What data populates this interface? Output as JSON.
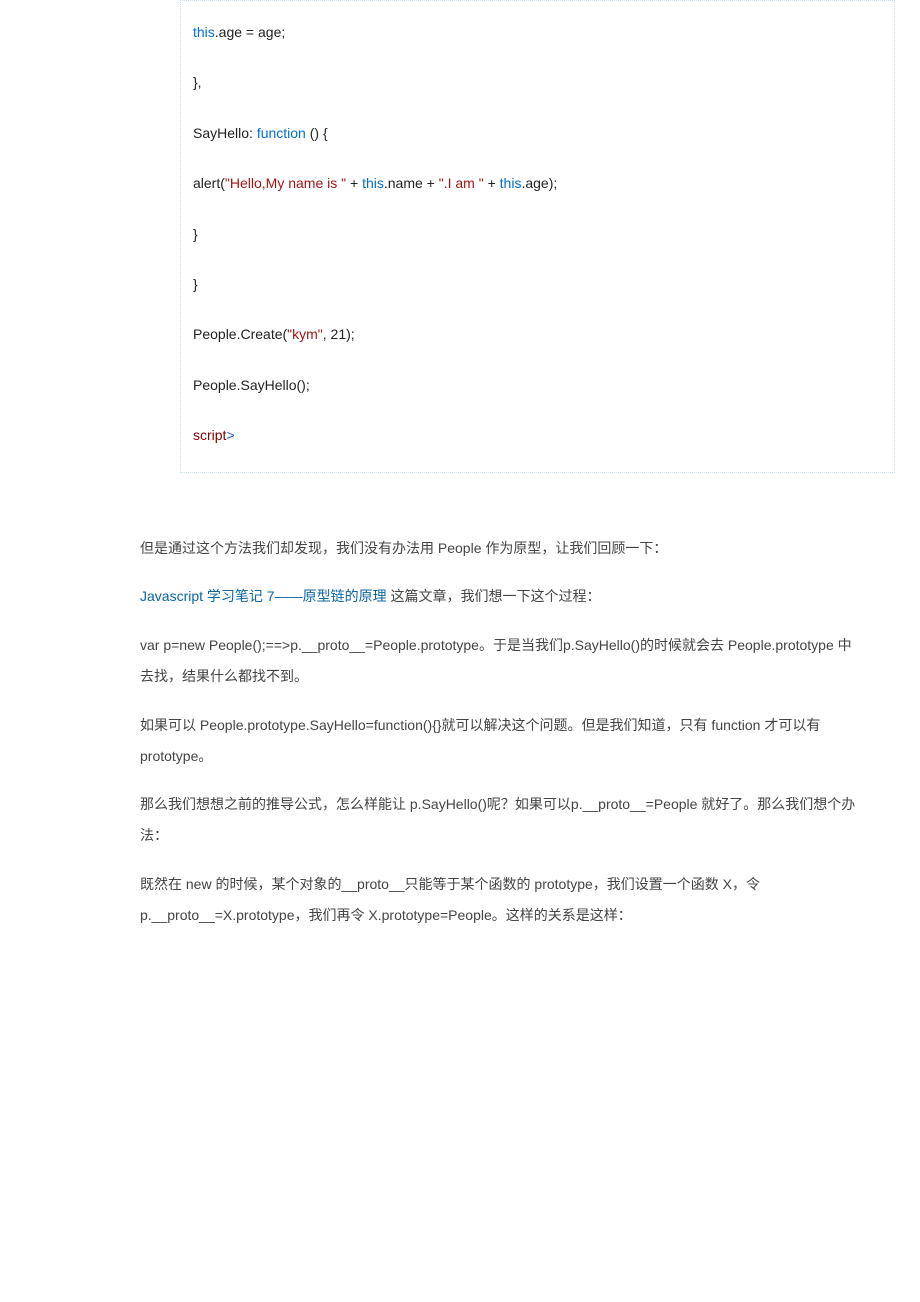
{
  "code": {
    "lines": [
      [
        {
          "cls": "kw",
          "t": "this"
        },
        {
          "cls": "plain",
          "t": ".age = age;"
        }
      ],
      [
        {
          "cls": "plain",
          "t": "},"
        }
      ],
      [
        {
          "cls": "plain",
          "t": "SayHello: "
        },
        {
          "cls": "kw",
          "t": "function"
        },
        {
          "cls": "plain",
          "t": " () {"
        }
      ],
      [
        {
          "cls": "plain",
          "t": "alert("
        },
        {
          "cls": "str",
          "t": "\"Hello,My name is \""
        },
        {
          "cls": "plain",
          "t": " + "
        },
        {
          "cls": "kw",
          "t": "this"
        },
        {
          "cls": "plain",
          "t": ".name + "
        },
        {
          "cls": "str",
          "t": "\".I am \""
        },
        {
          "cls": "plain",
          "t": " + "
        },
        {
          "cls": "kw",
          "t": "this"
        },
        {
          "cls": "plain",
          "t": ".age);"
        }
      ],
      [
        {
          "cls": "plain",
          "t": "}"
        }
      ],
      [
        {
          "cls": "plain",
          "t": "}"
        }
      ],
      [
        {
          "cls": "plain",
          "t": "People.Create("
        },
        {
          "cls": "str",
          "t": "\"kym\""
        },
        {
          "cls": "plain",
          "t": ", 21);"
        }
      ],
      [
        {
          "cls": "plain",
          "t": "People.SayHello();"
        }
      ],
      [
        {
          "cls": "tag",
          "t": "script"
        },
        {
          "cls": "sym",
          "t": ">"
        }
      ]
    ]
  },
  "body": {
    "p1": "但是通过这个方法我们却发现，我们没有办法用 People 作为原型，让我们回顾一下：",
    "p2_link": "Javascript 学习笔记 7——原型链的原理",
    "p2_rest": " 这篇文章，我们想一下这个过程：",
    "p3": "var p=new People();==>p.__proto__=People.prototype。于是当我们p.SayHello()的时候就会去 People.prototype 中去找，结果什么都找不到。",
    "p4": "如果可以 People.prototype.SayHello=function(){}就可以解决这个问题。但是我们知道，只有 function 才可以有 prototype。",
    "p5": "那么我们想想之前的推导公式，怎么样能让 p.SayHello()呢？如果可以p.__proto__=People 就好了。那么我们想个办法：",
    "p6": "既然在 new 的时候，某个对象的__proto__只能等于某个函数的 prototype，我们设置一个函数 X，令 p.__proto__=X.prototype，我们再令 X.prototype=People。这样的关系是这样："
  }
}
